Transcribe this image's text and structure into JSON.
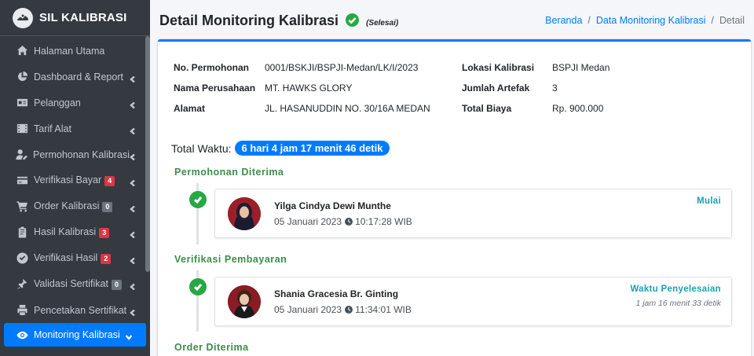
{
  "sidebar": {
    "brand": "SIL KALIBRASI",
    "items": [
      {
        "label": "Halaman Utama",
        "icon": "home-icon",
        "chevron": false
      },
      {
        "label": "Dashboard & Report",
        "icon": "chart-pie-icon",
        "chevron": true
      },
      {
        "label": "Pelanggan",
        "icon": "id-card-icon",
        "chevron": true
      },
      {
        "label": "Tarif Alat",
        "icon": "film-icon",
        "chevron": true
      },
      {
        "label": "Permohonan Kalibrasi",
        "icon": "user-edit-icon",
        "chevron": true
      },
      {
        "label": "Verifikasi Bayar",
        "icon": "credit-card-icon",
        "chevron": true,
        "badge": "4",
        "badge_color": "#dc3545"
      },
      {
        "label": "Order Kalibrasi",
        "icon": "cart-icon",
        "chevron": true,
        "badge": "0",
        "badge_color": "#6c757d"
      },
      {
        "label": "Hasil Kalibrasi",
        "icon": "clipboard-icon",
        "chevron": true,
        "badge": "3",
        "badge_color": "#dc3545"
      },
      {
        "label": "Verifikasi Hasil",
        "icon": "check-circle-icon",
        "chevron": true,
        "badge": "2",
        "badge_color": "#dc3545"
      },
      {
        "label": "Validasi Sertifikat",
        "icon": "stamp-icon",
        "chevron": true,
        "badge": "0",
        "badge_color": "#6c757d"
      },
      {
        "label": "Pencetakan Sertifikat",
        "icon": "printer-icon",
        "chevron": true
      },
      {
        "label": "Monitoring Kalibrasi",
        "icon": "eye-icon",
        "chevron": true,
        "active": true
      }
    ]
  },
  "header": {
    "title": "Detail Monitoring Kalibrasi",
    "status": "(Selesai)",
    "breadcrumb": [
      "Beranda",
      "Data Monitoring Kalibrasi",
      "Detail"
    ]
  },
  "info": {
    "no_permohonan_label": "No. Permohonan",
    "no_permohonan": "0001/BSKJI/BSPJI-Medan/LK/I/2023",
    "nama_perusahaan_label": "Nama Perusahaan",
    "nama_perusahaan": "MT. HAWKS GLORY",
    "alamat_label": "Alamat",
    "alamat": "JL. HASANUDDIN NO. 30/16A MEDAN",
    "lokasi_label": "Lokasi Kalibrasi",
    "lokasi": "BSPJI Medan",
    "jumlah_artefak_label": "Jumlah Artefak",
    "jumlah_artefak": "3",
    "total_biaya_label": "Total Biaya",
    "total_biaya": "Rp. 900.000"
  },
  "total_waktu": {
    "label": "Total Waktu:",
    "value": "6 hari 4 jam 17 menit 46 detik"
  },
  "timeline": [
    {
      "stage": "Permohonan Diterima",
      "person": "Yilga Cindya Dewi Munthe",
      "date": "05 Januari 2023",
      "time": "10:17:28 WIB",
      "right_label": "Mulai",
      "right_sub": ""
    },
    {
      "stage": "Verifikasi Pembayaran",
      "person": "Shania Gracesia Br. Ginting",
      "date": "05 Januari 2023",
      "time": "11:34:01 WIB",
      "right_label": "Waktu Penyelesaian",
      "right_sub": "1 jam 16 menit 33 detik"
    },
    {
      "stage": "Order Diterima"
    }
  ],
  "colors": {
    "primary": "#007bff",
    "success": "#28a745",
    "info": "#17a2b8",
    "sidebar_bg": "#343a40"
  }
}
